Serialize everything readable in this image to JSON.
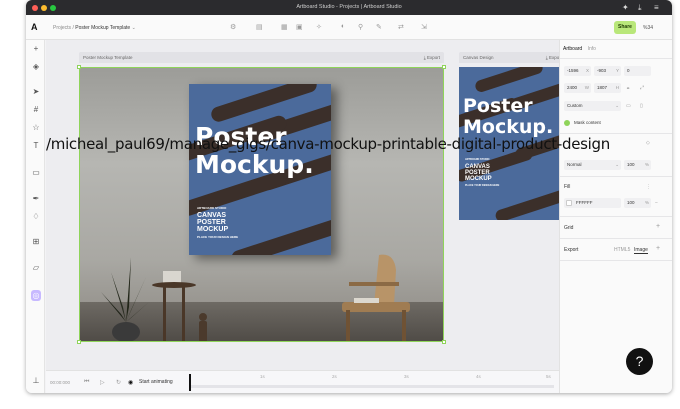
{
  "window": {
    "title": "Artboard Studio - Projects | Artboard Studio"
  },
  "toolbar": {
    "breadcrumb_root": "Projects",
    "breadcrumb_sep": "/",
    "breadcrumb_current": "Poster Mockup Template",
    "share_label": "Share",
    "zoom": "%34"
  },
  "canvas": {
    "frame1_label": "Poster Mockup Template",
    "frame1_export": "Export",
    "frame2_label": "Canvas Design",
    "frame2_export": "Export",
    "overlay_text": "/micheal_paul69/manage_gigs/canva-mockup-printable-digital-product-design"
  },
  "poster": {
    "title_line1": "Poster",
    "title_line2": "Mockup.",
    "studio": "ARTBOARD STUDIO",
    "sub1": "CANVAS",
    "sub2": "POSTER",
    "sub3": "MOCKUP",
    "place": "PLACE YOUR DESIGN HERE"
  },
  "timeline": {
    "time": "00:00:000",
    "anim_label": "Start animating",
    "ticks": [
      "1s",
      "2s",
      "3s",
      "4s",
      "5s"
    ]
  },
  "panel": {
    "tab_artboard": "Artboard",
    "tab_info": "Info",
    "x_value": "-1596",
    "x_unit": "X",
    "y_value": "-903",
    "y_unit": "Y",
    "rot_value": "0",
    "w_value": "2400",
    "w_unit": "W",
    "h_value": "1807",
    "h_unit": "H",
    "preset": "Custom",
    "mask_label": "Mask content",
    "blend": "Normal",
    "opacity": "100",
    "opacity_unit": "%",
    "fill_label": "Fill",
    "fill_hex": "FFFFFF",
    "fill_opacity": "100",
    "fill_unit": "%",
    "grid_label": "Grid",
    "export_label": "Export",
    "export_html": "HTML5",
    "export_image": "Image"
  },
  "colors": {
    "accent_green": "#8fd45a",
    "share_bg": "#b9e77a",
    "poster_blue": "#4b6a9b",
    "stripe_brown": "#3b2f2a"
  },
  "help_label": "?"
}
